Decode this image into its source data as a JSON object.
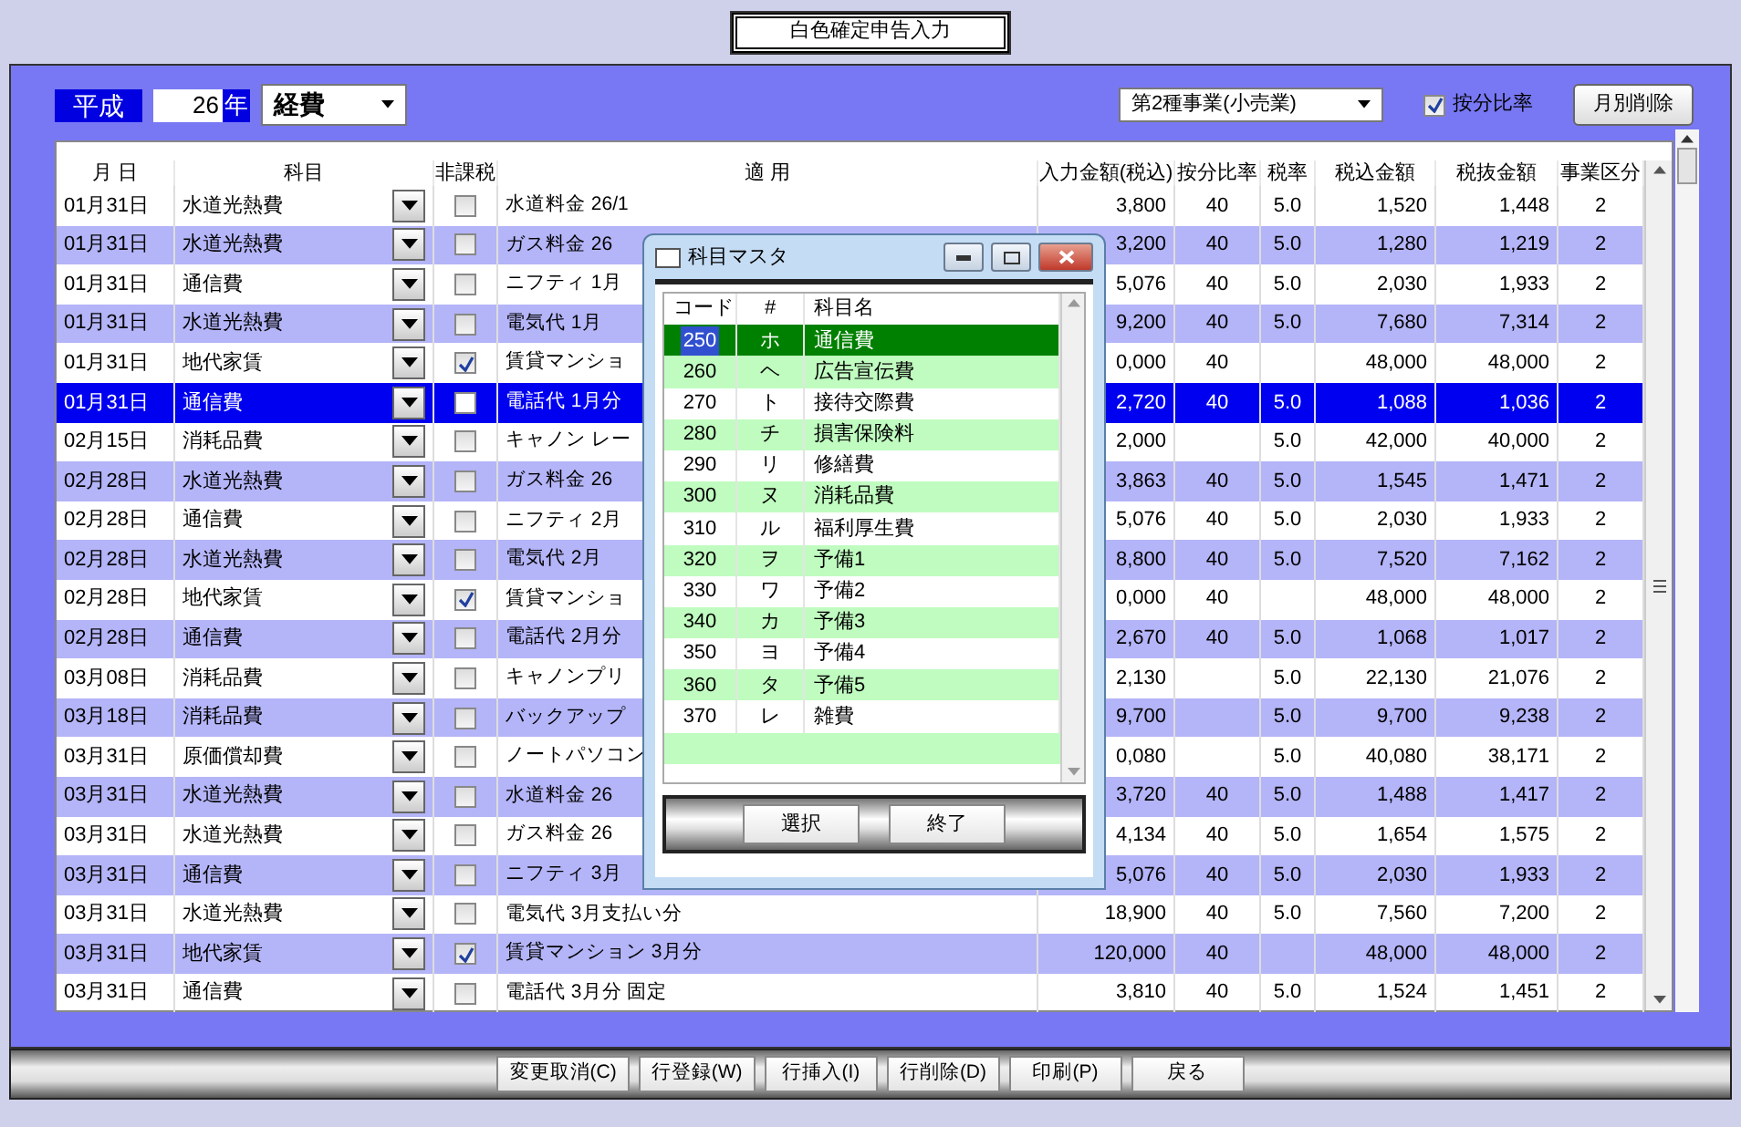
{
  "title": "白色確定申告入力",
  "era": "平成",
  "year": "26",
  "year_unit": "年",
  "category_select": "経費",
  "business_select": "第2種事業(小売業)",
  "prorate": {
    "label": "按分比率",
    "checked": true
  },
  "monthly_delete_button": "月別削除",
  "table": {
    "columns": [
      "月 日",
      "科目",
      "非課税",
      "適 用",
      "入力金額(税込)",
      "按分比率",
      "税率",
      "税込金額",
      "税抜金額",
      "事業区分"
    ],
    "rows": [
      {
        "date": "01月31日",
        "account": "水道光熱費",
        "tax_exempt": false,
        "description": "水道料金 26/1",
        "amount": "3,800",
        "ratio": "40",
        "rate": "5.0",
        "tax_incl": "1,520",
        "tax_excl": "1,448",
        "business": "2",
        "selected": false
      },
      {
        "date": "01月31日",
        "account": "水道光熱費",
        "tax_exempt": false,
        "description": "ガス料金 26",
        "amount": "3,200",
        "ratio": "40",
        "rate": "5.0",
        "tax_incl": "1,280",
        "tax_excl": "1,219",
        "business": "2",
        "selected": false
      },
      {
        "date": "01月31日",
        "account": "通信費",
        "tax_exempt": false,
        "description": "ニフティ 1月",
        "amount": "5,076",
        "ratio": "40",
        "rate": "5.0",
        "tax_incl": "2,030",
        "tax_excl": "1,933",
        "business": "2",
        "selected": false
      },
      {
        "date": "01月31日",
        "account": "水道光熱費",
        "tax_exempt": false,
        "description": "電気代 1月",
        "amount": "9,200",
        "ratio": "40",
        "rate": "5.0",
        "tax_incl": "7,680",
        "tax_excl": "7,314",
        "business": "2",
        "selected": false
      },
      {
        "date": "01月31日",
        "account": "地代家賃",
        "tax_exempt": true,
        "description": "賃貸マンショ",
        "amount": "0,000",
        "ratio": "40",
        "tax_incl": "48,000",
        "tax_excl": "48,000",
        "business": "2",
        "selected": false
      },
      {
        "date": "01月31日",
        "account": "通信費",
        "tax_exempt": false,
        "description": "電話代 1月分",
        "amount": "2,720",
        "ratio": "40",
        "rate": "5.0",
        "tax_incl": "1,088",
        "tax_excl": "1,036",
        "business": "2",
        "selected": true
      },
      {
        "date": "02月15日",
        "account": "消耗品費",
        "tax_exempt": false,
        "description": "キャノン レー",
        "amount": "2,000",
        "rate": "5.0",
        "tax_incl": "42,000",
        "tax_excl": "40,000",
        "business": "2",
        "selected": false
      },
      {
        "date": "02月28日",
        "account": "水道光熱費",
        "tax_exempt": false,
        "description": "ガス料金 26",
        "amount": "3,863",
        "ratio": "40",
        "rate": "5.0",
        "tax_incl": "1,545",
        "tax_excl": "1,471",
        "business": "2",
        "selected": false
      },
      {
        "date": "02月28日",
        "account": "通信費",
        "tax_exempt": false,
        "description": "ニフティ 2月",
        "amount": "5,076",
        "ratio": "40",
        "rate": "5.0",
        "tax_incl": "2,030",
        "tax_excl": "1,933",
        "business": "2",
        "selected": false
      },
      {
        "date": "02月28日",
        "account": "水道光熱費",
        "tax_exempt": false,
        "description": "電気代 2月",
        "amount": "8,800",
        "ratio": "40",
        "rate": "5.0",
        "tax_incl": "7,520",
        "tax_excl": "7,162",
        "business": "2",
        "selected": false
      },
      {
        "date": "02月28日",
        "account": "地代家賃",
        "tax_exempt": true,
        "description": "賃貸マンショ",
        "amount": "0,000",
        "ratio": "40",
        "tax_incl": "48,000",
        "tax_excl": "48,000",
        "business": "2",
        "selected": false
      },
      {
        "date": "02月28日",
        "account": "通信費",
        "tax_exempt": false,
        "description": "電話代 2月分",
        "amount": "2,670",
        "ratio": "40",
        "rate": "5.0",
        "tax_incl": "1,068",
        "tax_excl": "1,017",
        "business": "2",
        "selected": false
      },
      {
        "date": "03月08日",
        "account": "消耗品費",
        "tax_exempt": false,
        "description": "キャノンプリ",
        "amount": "2,130",
        "rate": "5.0",
        "tax_incl": "22,130",
        "tax_excl": "21,076",
        "business": "2",
        "selected": false
      },
      {
        "date": "03月18日",
        "account": "消耗品費",
        "tax_exempt": false,
        "description": "バックアップ",
        "amount": "9,700",
        "rate": "5.0",
        "tax_incl": "9,700",
        "tax_excl": "9,238",
        "business": "2",
        "selected": false
      },
      {
        "date": "03月31日",
        "account": "原価償却費",
        "tax_exempt": false,
        "description": "ノートパソコン",
        "amount": "0,080",
        "rate": "5.0",
        "tax_incl": "40,080",
        "tax_excl": "38,171",
        "business": "2",
        "selected": false
      },
      {
        "date": "03月31日",
        "account": "水道光熱費",
        "tax_exempt": false,
        "description": "水道料金 26",
        "amount": "3,720",
        "ratio": "40",
        "rate": "5.0",
        "tax_incl": "1,488",
        "tax_excl": "1,417",
        "business": "2",
        "selected": false
      },
      {
        "date": "03月31日",
        "account": "水道光熱費",
        "tax_exempt": false,
        "description": "ガス料金 26",
        "amount": "4,134",
        "ratio": "40",
        "rate": "5.0",
        "tax_incl": "1,654",
        "tax_excl": "1,575",
        "business": "2",
        "selected": false
      },
      {
        "date": "03月31日",
        "account": "通信費",
        "tax_exempt": false,
        "description": "ニフティ 3月",
        "amount": "5,076",
        "ratio": "40",
        "rate": "5.0",
        "tax_incl": "2,030",
        "tax_excl": "1,933",
        "business": "2",
        "selected": false
      },
      {
        "date": "03月31日",
        "account": "水道光熱費",
        "tax_exempt": false,
        "description": "電気代 3月支払い分",
        "amount": "18,900",
        "ratio": "40",
        "rate": "5.0",
        "tax_incl": "7,560",
        "tax_excl": "7,200",
        "business": "2",
        "selected": false
      },
      {
        "date": "03月31日",
        "account": "地代家賃",
        "tax_exempt": true,
        "description": "賃貸マンション 3月分",
        "amount": "120,000",
        "ratio": "40",
        "tax_incl": "48,000",
        "tax_excl": "48,000",
        "business": "2",
        "selected": false
      },
      {
        "date": "03月31日",
        "account": "通信費",
        "tax_exempt": false,
        "description": "電話代 3月分 固定",
        "amount": "3,810",
        "ratio": "40",
        "rate": "5.0",
        "tax_incl": "1,524",
        "tax_excl": "1,451",
        "business": "2",
        "selected": false
      }
    ]
  },
  "dialog": {
    "title": "科目マスタ",
    "columns": [
      "コード",
      "#",
      "科目名"
    ],
    "rows": [
      {
        "code": "250",
        "kana": "ホ",
        "name": "通信費",
        "selected": true
      },
      {
        "code": "260",
        "kana": "ヘ",
        "name": "広告宣伝費",
        "selected": false
      },
      {
        "code": "270",
        "kana": "ト",
        "name": "接待交際費",
        "selected": false
      },
      {
        "code": "280",
        "kana": "チ",
        "name": "損害保険料",
        "selected": false
      },
      {
        "code": "290",
        "kana": "リ",
        "name": "修繕費",
        "selected": false
      },
      {
        "code": "300",
        "kana": "ヌ",
        "name": "消耗品費",
        "selected": false
      },
      {
        "code": "310",
        "kana": "ル",
        "name": "福利厚生費",
        "selected": false
      },
      {
        "code": "320",
        "kana": "ヲ",
        "name": "予備1",
        "selected": false
      },
      {
        "code": "330",
        "kana": "ワ",
        "name": "予備2",
        "selected": false
      },
      {
        "code": "340",
        "kana": "カ",
        "name": "予備3",
        "selected": false
      },
      {
        "code": "350",
        "kana": "ヨ",
        "name": "予備4",
        "selected": false
      },
      {
        "code": "360",
        "kana": "タ",
        "name": "予備5",
        "selected": false
      },
      {
        "code": "370",
        "kana": "レ",
        "name": "雑費",
        "selected": false
      }
    ],
    "buttons": [
      "選択",
      "終了"
    ]
  },
  "buttons": [
    "変更取消(C)",
    "行登録(W)",
    "行挿入(I)",
    "行削除(D)",
    "印刷(P)",
    "戻る"
  ]
}
